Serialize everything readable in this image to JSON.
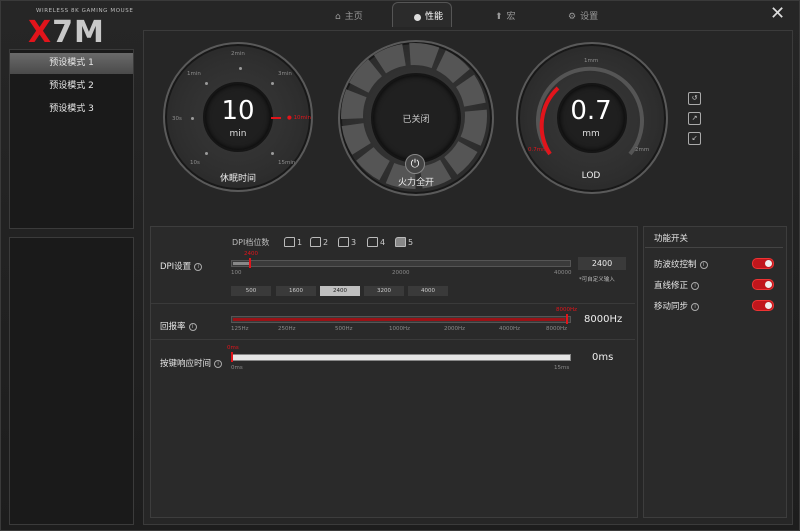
{
  "brand": {
    "subtitle": "WIRELESS 8K GAMING MOUSE",
    "logo_x": "X",
    "logo_rest": "7M",
    "accent": "#e2141b"
  },
  "tabs": [
    {
      "label": "主页",
      "icon": "home-icon"
    },
    {
      "label": "性能",
      "icon": "gauge-icon"
    },
    {
      "label": "宏",
      "icon": "macro-icon"
    },
    {
      "label": "设置",
      "icon": "gear-icon"
    }
  ],
  "presets": [
    "预设模式 1",
    "预设模式 2",
    "预设模式 3"
  ],
  "sleep": {
    "value": "10",
    "unit": "min",
    "label": "休眠时间",
    "marker": "10min",
    "ticks": [
      "2min",
      "3min",
      "1min",
      "30s",
      "10s",
      "15min"
    ]
  },
  "fire": {
    "status": "已关闭",
    "label": "火力全开"
  },
  "lod": {
    "value": "0.7",
    "unit": "mm",
    "label": "LOD",
    "min": "0.7mm",
    "max": "2mm",
    "top": "1mm"
  },
  "dpi": {
    "label": "DPI设置",
    "level_label": "DPI档位数",
    "levels": [
      "1",
      "2",
      "3",
      "4",
      "5"
    ],
    "current": "2400",
    "min": "100",
    "mid": "20000",
    "max": "40000",
    "value_box": "2400",
    "note": "*可自定义输入",
    "presets": [
      "500",
      "1600",
      "2400",
      "3200",
      "4000"
    ],
    "selected_preset": "2400"
  },
  "polling": {
    "label": "回报率",
    "marker": "8000Hz",
    "value": "8000Hz",
    "ticks": [
      "125Hz",
      "250Hz",
      "500Hz",
      "1000Hz",
      "2000Hz",
      "4000Hz",
      "8000Hz"
    ]
  },
  "debounce": {
    "label": "按键响应时间",
    "marker": "0ms",
    "min": "0ms",
    "max": "15ms",
    "value": "0ms"
  },
  "features": {
    "title": "功能开关",
    "items": [
      {
        "label": "防波纹控制",
        "on": true
      },
      {
        "label": "直线修正",
        "on": true
      },
      {
        "label": "移动同步",
        "on": true
      }
    ]
  }
}
